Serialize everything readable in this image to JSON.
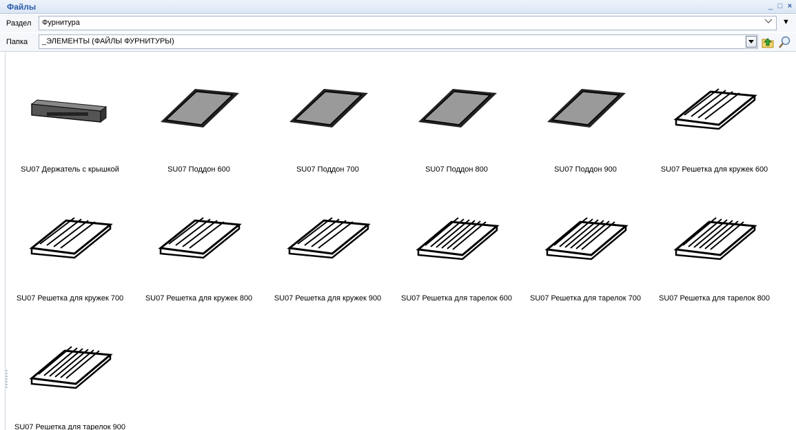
{
  "window": {
    "title": "Файлы",
    "minimize_glyph": "_",
    "maximize_glyph": "□",
    "close_glyph": "×"
  },
  "section": {
    "label": "Раздел",
    "value": "Фурнитура",
    "menu_glyph": "▼"
  },
  "folder": {
    "label": "Папка",
    "value": "_ЭЛЕМЕНТЫ (ФАЙЛЫ ФУРНИТУРЫ)"
  },
  "toolbar": {
    "up_icon": "folder-up-icon",
    "search_icon": "search-icon"
  },
  "items": [
    {
      "caption": "SU07 Держатель с крышкой",
      "icon": "holder-thumbnail"
    },
    {
      "caption": "SU07 Поддон 600",
      "icon": "tray-thumbnail"
    },
    {
      "caption": "SU07 Поддон 700",
      "icon": "tray-thumbnail"
    },
    {
      "caption": "SU07 Поддон 800",
      "icon": "tray-thumbnail"
    },
    {
      "caption": "SU07 Поддон 900",
      "icon": "tray-thumbnail"
    },
    {
      "caption": "SU07 Решетка для кружек 600",
      "icon": "cup-rack-thumbnail"
    },
    {
      "caption": "SU07 Решетка для кружек 700",
      "icon": "cup-rack-thumbnail"
    },
    {
      "caption": "SU07 Решетка для кружек 800",
      "icon": "cup-rack-thumbnail"
    },
    {
      "caption": "SU07 Решетка для кружек 900",
      "icon": "cup-rack-thumbnail"
    },
    {
      "caption": "SU07 Решетка для тарелок 600",
      "icon": "plate-rack-thumbnail"
    },
    {
      "caption": "SU07 Решетка для тарелок 700",
      "icon": "plate-rack-thumbnail"
    },
    {
      "caption": "SU07 Решетка для тарелок 800",
      "icon": "plate-rack-thumbnail"
    },
    {
      "caption": "SU07 Решетка для тарелок 900",
      "icon": "plate-rack-thumbnail"
    }
  ]
}
